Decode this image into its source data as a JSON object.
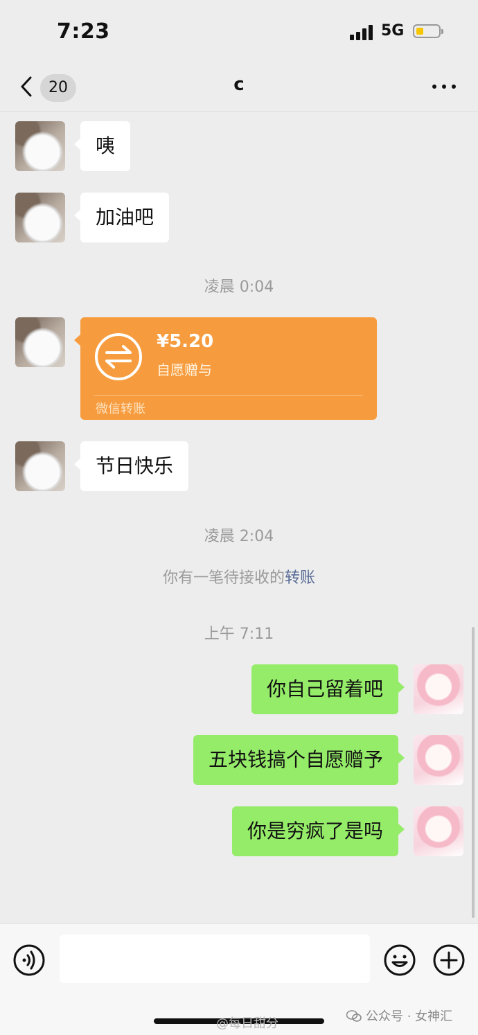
{
  "status_bar": {
    "time": "7:23",
    "network": "5G"
  },
  "nav": {
    "unread_count": "20",
    "title": "c"
  },
  "messages": [
    {
      "side": "in",
      "text": "咦"
    },
    {
      "side": "in",
      "text": "加油吧"
    },
    {
      "side": "out",
      "text": "你自己留着吧"
    },
    {
      "side": "out",
      "text": "五块钱搞个自愿赠予"
    },
    {
      "side": "out",
      "text": "你是穷疯了是吗"
    }
  ],
  "festival_message": "节日快乐",
  "timestamps": {
    "first": "凌晨 0:04",
    "second": "凌晨 2:04",
    "third": "上午 7:11"
  },
  "transfer": {
    "amount": "¥5.20",
    "note": "自愿赠与",
    "label": "微信转账",
    "color": "#f79c3e"
  },
  "system": {
    "prefix": "你有一笔待接收的",
    "link": "转账"
  },
  "colors": {
    "background": "#ededed",
    "incoming_bubble": "#ffffff",
    "outgoing_bubble": "#95ec69",
    "link": "#576b95"
  },
  "watermarks": {
    "weibo": "@每日甜分",
    "wechat": "公众号 · 女神汇"
  },
  "icons": {
    "back": "chevron-left-icon",
    "more": "more-dots-icon",
    "voice": "voice-icon",
    "emoji": "emoji-icon",
    "plus": "plus-icon",
    "transfer": "transfer-arrows-icon"
  }
}
